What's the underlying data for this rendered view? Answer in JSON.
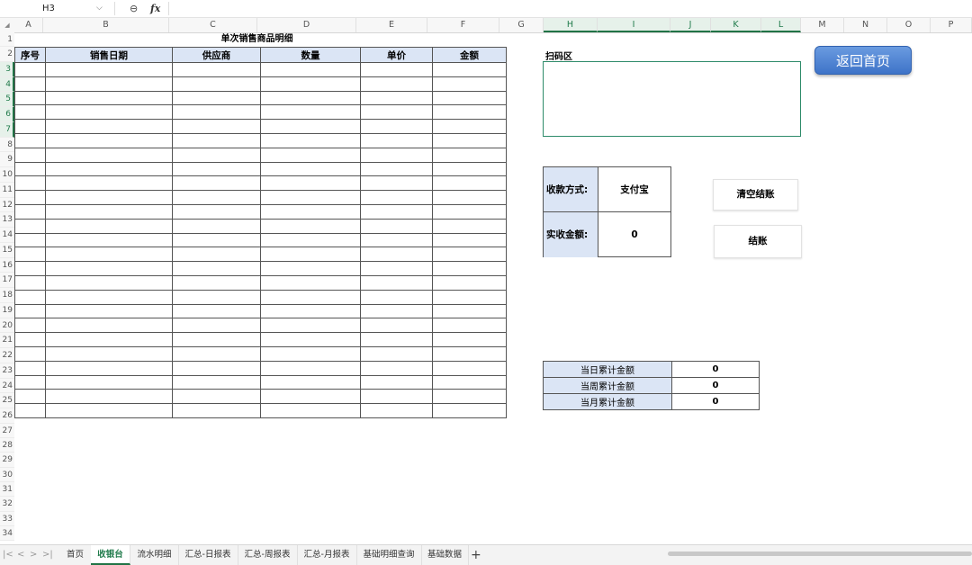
{
  "formula_bar": {
    "name_box": "H3",
    "name_dropdown": "⌵",
    "zoom_icon": "⊖",
    "fx": "fx"
  },
  "corner_mark": "◢",
  "columns": [
    "A",
    "B",
    "C",
    "D",
    "E",
    "F",
    "G",
    "H",
    "I",
    "J",
    "K",
    "L",
    "M",
    "N",
    "O",
    "P"
  ],
  "rows": [
    "1",
    "2",
    "3",
    "4",
    "5",
    "6",
    "7",
    "8",
    "9",
    "10",
    "11",
    "12",
    "13",
    "14",
    "15",
    "16",
    "17",
    "18",
    "19",
    "20",
    "21",
    "22",
    "23",
    "24",
    "25",
    "26",
    "27",
    "28",
    "29",
    "30",
    "31",
    "32",
    "33",
    "34"
  ],
  "detail_table": {
    "title": "单次销售商品明细",
    "headers": [
      "序号",
      "销售日期",
      "供应商",
      "数量",
      "单价",
      "金额"
    ]
  },
  "scan": {
    "label": "扫码区",
    "value": ""
  },
  "payment": {
    "method_label": "收款方式:",
    "method_value": "支付宝",
    "received_label": "实收金额:",
    "received_value": "0"
  },
  "buttons": {
    "home": "返回首页",
    "clear_checkout": "清空结账",
    "checkout": "结账"
  },
  "summary": [
    {
      "label": "当日累计金额",
      "value": "0"
    },
    {
      "label": "当周累计金额",
      "value": "0"
    },
    {
      "label": "当月累计金额",
      "value": "0"
    }
  ],
  "sheet_nav": [
    "|<",
    "<",
    ">",
    ">|"
  ],
  "tabs": [
    "首页",
    "收银台",
    "流水明细",
    "汇总-日报表",
    "汇总-周报表",
    "汇总-月报表",
    "基础明细查询",
    "基础数据"
  ],
  "active_tab": "收银台",
  "add_tab": "+",
  "accent_color": "#217346",
  "header_fill_color": "#dbe5f5"
}
